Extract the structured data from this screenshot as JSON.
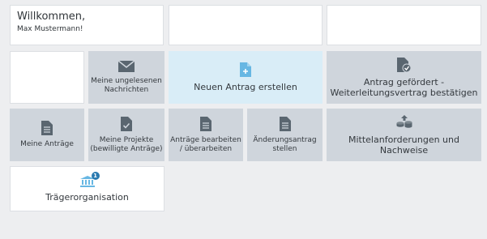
{
  "welcome": {
    "greeting": "Willkommen,",
    "name": "Max Mustermann!"
  },
  "tiles": {
    "messages": "Meine ungelesenen Nachrichten",
    "new_application": "Neuen Antrag erstellen",
    "confirm_contract": "Antrag gefördert - Weiterleitungsvertrag bestätigen",
    "my_applications": "Meine Anträge",
    "my_projects": "Meine Projekte (bewilligte Anträge)",
    "edit_applications": "Anträge bearbeiten / überarbeiten",
    "change_request": "Änderungsantrag stellen",
    "fund_requests": "Mittelanforderungen und Nachweise",
    "organization": "Trägerorganisation"
  },
  "badges": {
    "organization_count": "1"
  },
  "colors": {
    "tile_grey": "#cfd5dc",
    "tile_blue": "#d9edf7",
    "icon_grey": "#5a6670",
    "icon_blue": "#67b7e3",
    "badge": "#2a7ab0"
  },
  "icons": {
    "messages": "envelope-icon",
    "new_application": "document-plus-icon",
    "confirm_contract": "document-check-icon",
    "my_applications": "document-icon",
    "my_projects": "document-check-icon",
    "edit_applications": "document-icon",
    "change_request": "document-icon",
    "fund_requests": "coins-upload-icon",
    "organization": "institution-icon"
  }
}
